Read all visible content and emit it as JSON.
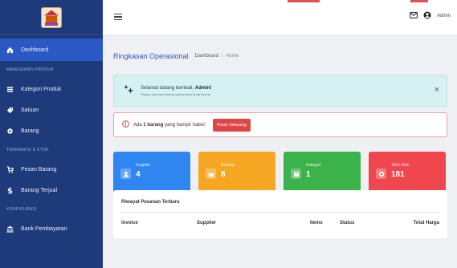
{
  "sidebar": {
    "dashboard": "Dashboard",
    "sections": [
      {
        "header": "MANAJEMEN PRODUK",
        "items": [
          "Kategori Produk",
          "Satuan",
          "Barang"
        ]
      },
      {
        "header": "TRANSAKSI & STOK",
        "items": [
          "Pesan Barang",
          "Barang Terjual"
        ]
      },
      {
        "header": "KONFIGURASI",
        "items": [
          "Bank Pembayaran"
        ]
      }
    ]
  },
  "topbar": {
    "user": "Admin"
  },
  "page": {
    "title": "Ringkasan Operasional",
    "breadcrumb": [
      "Dashboard",
      "Home"
    ]
  },
  "welcome": {
    "prefix": "Selamat datang kembali,",
    "name": "Admin!",
    "subtitle": "Pantau stok dan kinerja usaha pada Anda hari ini."
  },
  "alert": {
    "prefix": "Ada",
    "count": "1 barang",
    "suffix": "yang hampir habis!",
    "button": "Pesan Sekarang"
  },
  "stats": [
    {
      "label": "Supplier",
      "value": "4",
      "color": "#2f86f0"
    },
    {
      "label": "Barang",
      "value": "8",
      "color": "#f5a623"
    },
    {
      "label": "Kategori",
      "value": "1",
      "color": "#3cb24a"
    },
    {
      "label": "Total Stok",
      "value": "181",
      "color": "#f0474f"
    }
  ],
  "orders": {
    "title": "Riwayat Pesanan Terbaru",
    "columns": [
      "Invoice",
      "Supplier",
      "Items",
      "Status",
      "Total Harga"
    ]
  },
  "colors": {
    "sidebar": "#1d3a7a",
    "sidebar_active": "#2b59c3",
    "accent": "#2b59c3"
  }
}
